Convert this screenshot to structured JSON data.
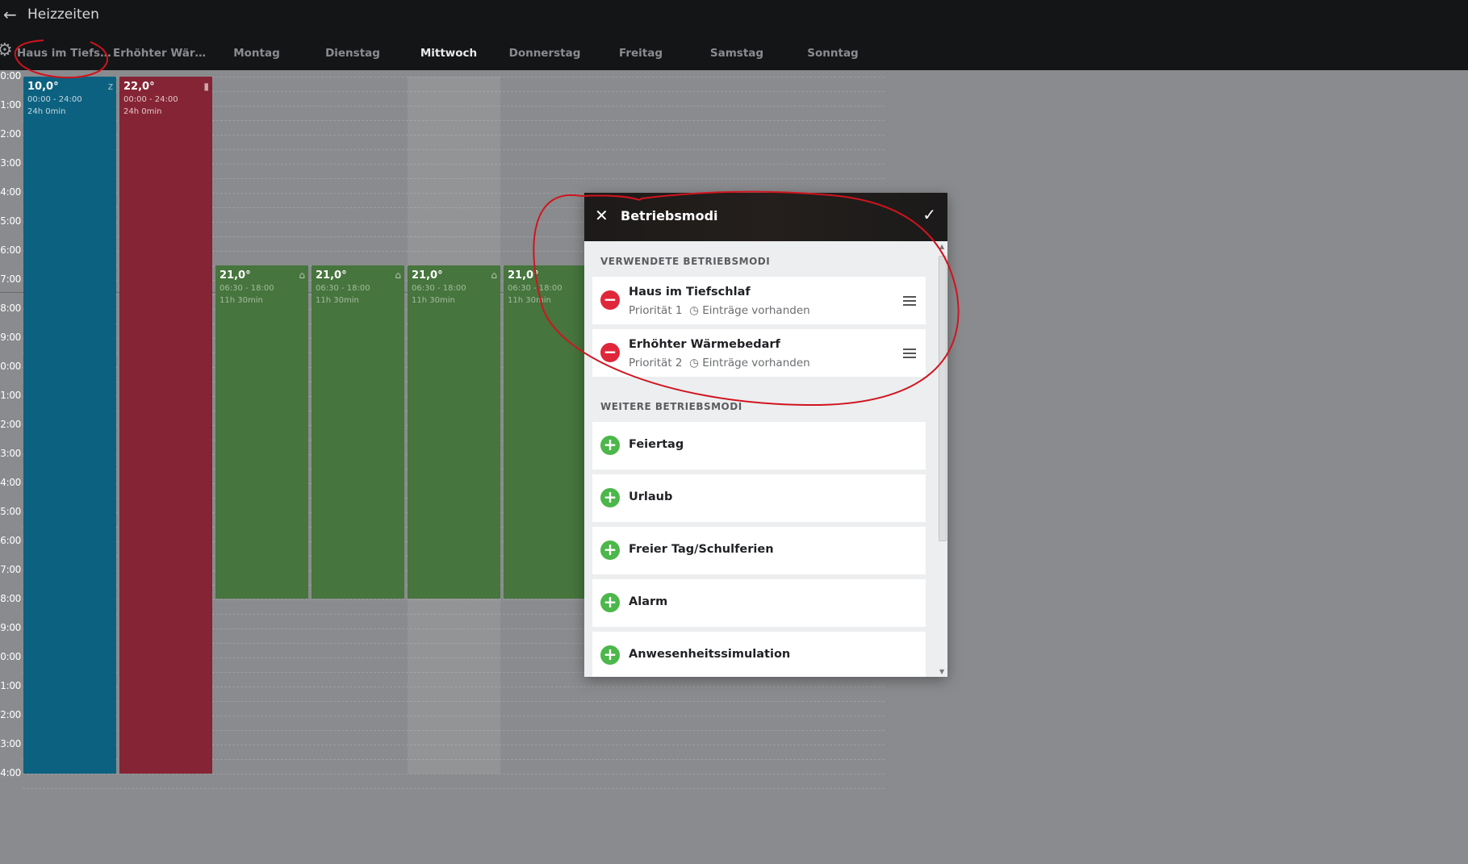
{
  "header": {
    "back_icon": "arrow-left-icon",
    "title": "Heizzeiten",
    "settings_icon": "gear-icon"
  },
  "tabs": [
    {
      "label": "Haus im Tiefsc...",
      "active": false
    },
    {
      "label": "Erhöhter Wärm...",
      "active": false
    },
    {
      "label": "Montag",
      "active": false
    },
    {
      "label": "Dienstag",
      "active": false
    },
    {
      "label": "Mittwoch",
      "active": true
    },
    {
      "label": "Donnerstag",
      "active": false
    },
    {
      "label": "Freitag",
      "active": false
    },
    {
      "label": "Samstag",
      "active": false
    },
    {
      "label": "Sonntag",
      "active": false
    }
  ],
  "hours": [
    "0:00",
    "1:00",
    "2:00",
    "3:00",
    "4:00",
    "5:00",
    "6:00",
    "7:00",
    "8:00",
    "9:00",
    "0:00",
    "1:00",
    "2:00",
    "3:00",
    "4:00",
    "5:00",
    "6:00",
    "7:00",
    "8:00",
    "9:00",
    "0:00",
    "1:00",
    "2:00",
    "3:00",
    "4:00"
  ],
  "blocks": {
    "tiefschlaf": {
      "temp": "10,0°",
      "time": "00:00 - 24:00",
      "duration": "24h 0min",
      "icon": "sleep-icon",
      "color": "#0d6180"
    },
    "waerme": {
      "temp": "22,0°",
      "time": "00:00 - 24:00",
      "duration": "24h 0min",
      "icon": "thermometer-icon",
      "color": "#852434"
    },
    "montag": {
      "temp": "21,0°",
      "time": "06:30 - 18:00",
      "duration": "11h 30min",
      "icon": "home-icon"
    },
    "dienstag": {
      "temp": "21,0°",
      "time": "06:30 - 18:00",
      "duration": "11h 30min",
      "icon": "home-icon"
    },
    "mittwoch": {
      "temp": "21,0°",
      "time": "06:30 - 18:00",
      "duration": "11h 30min",
      "icon": "home-icon"
    },
    "donnerstag": {
      "temp": "21,0°",
      "time": "06:30 - 18:00",
      "duration": "11h 30min"
    }
  },
  "dialog": {
    "title": "Betriebsmodi",
    "close_icon": "close-icon",
    "confirm_icon": "check-icon",
    "used_section": "VERWENDETE BETRIEBSMODI",
    "used": [
      {
        "name": "Haus im Tiefschlaf",
        "priority": "Priorität 1",
        "entries": "Einträge vorhanden"
      },
      {
        "name": "Erhöhter Wärmebedarf",
        "priority": "Priorität 2",
        "entries": "Einträge vorhanden"
      }
    ],
    "more_section": "WEITERE BETRIEBSMODI",
    "more": [
      {
        "name": "Feiertag"
      },
      {
        "name": "Urlaub"
      },
      {
        "name": "Freier Tag/Schulferien"
      },
      {
        "name": "Alarm"
      },
      {
        "name": "Anwesenheitssimulation"
      }
    ]
  },
  "colors": {
    "accent_red": "#e0263a",
    "accent_green": "#4cb74a",
    "annotation": "#d0141e"
  }
}
